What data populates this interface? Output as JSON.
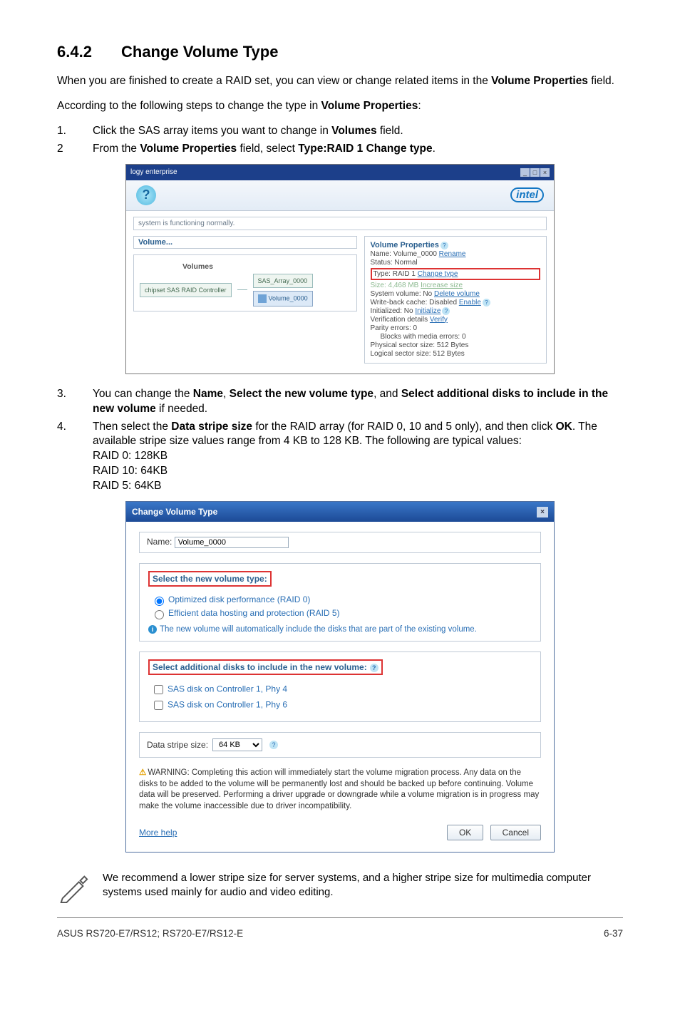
{
  "section": {
    "number": "6.4.2",
    "title": "Change Volume Type"
  },
  "para1": "When you are finished to create a RAID set, you can view or change related items in the ",
  "para1_b": "Volume Properties",
  "para1_tail": " field.",
  "para2_a": "According to the following steps to change the type in ",
  "para2_b": "Volume Properties",
  "para2_tail": ":",
  "step1_a": "Click the SAS array items you want to change in ",
  "step1_b": "Volumes",
  "step1_tail": " field.",
  "step2_a": "From the ",
  "step2_b1": "Volume Properties",
  "step2_mid": " field, select ",
  "step2_b2": "Type:RAID 1 Change type",
  "step2_tail": ".",
  "shot1": {
    "titlebar": "logy enterprise",
    "status": "system is functioning normally.",
    "left_hdr": "Volume...",
    "volumes_label": "Volumes",
    "ctrl_label": "chipset SAS RAID Controller",
    "sas_label": "SAS_Array_0000",
    "vol_label": "Volume_0000",
    "right_hdr": "Volume Properties",
    "r_name_lbl": "Name: Volume_0000 ",
    "r_name_link": "Rename",
    "r_status": "Status: Normal",
    "r_type_a": "Type: RAID 1 ",
    "r_type_link": "Change type",
    "r_size_a": "Size: 4,468 MB ",
    "r_size_link": "Increase size",
    "r_sysvol_a": "System volume: No ",
    "r_sysvol_link": "Delete volume",
    "r_wb_a": "Write-back cache: Disabled ",
    "r_wb_link": "Enable",
    "r_init_a": "Initialized: No ",
    "r_init_link": "Initialize",
    "r_verify_a": "Verification details ",
    "r_verify_link": "Verify",
    "r_parity": "Parity errors: 0",
    "r_blocks": "Blocks with media errors: 0",
    "r_psec": "Physical sector size: 512 Bytes",
    "r_lsec": "Logical sector size: 512 Bytes"
  },
  "step3_a": "You can change the ",
  "step3_b1": "Name",
  "step3_mid1": ", ",
  "step3_b2": "Select the new volume type",
  "step3_mid2": ", and ",
  "step3_b3": "Select additional disks to include in the new volume",
  "step3_tail": " if needed.",
  "step4_a": "Then select the ",
  "step4_b1": "Data stripe size",
  "step4_mid": " for the RAID array (for RAID 0, 10 and 5 only), and then click ",
  "step4_b2": "OK",
  "step4_tail": ". The available stripe size values range from 4 KB to 128 KB. The following are typical values:",
  "step4_l1": "RAID 0: 128KB",
  "step4_l2": "RAID 10: 64KB",
  "step4_l3": "RAID 5: 64KB",
  "shot2": {
    "title": "Change Volume Type",
    "name_lbl": "Name:",
    "name_val": "Volume_0000",
    "grp1_hdr": "Select the new volume type:",
    "r1": "Optimized disk performance (RAID 0)",
    "r2": "Efficient data hosting and protection (RAID 5)",
    "info": "The new volume will automatically include the disks that are part of the existing volume.",
    "grp2_hdr": "Select additional disks to include in the new volume:",
    "c1": "SAS disk on Controller 1, Phy 4",
    "c2": "SAS disk on Controller 1, Phy 6",
    "stripe_lbl": "Data stripe size:",
    "stripe_val": "64 KB",
    "warn": "WARNING: Completing this action will immediately start the volume migration process. Any data on the disks to be added to the volume will be permanently lost and should be backed up before continuing. Volume data will be preserved. Performing a driver upgrade or downgrade while a volume migration is in progress may make the volume inaccessible due to driver incompatibility.",
    "more": "More help",
    "ok": "OK",
    "cancel": "Cancel"
  },
  "note": "We recommend a lower stripe size for server systems, and a higher stripe size for multimedia computer systems used mainly for audio and video editing.",
  "footer_left": "ASUS RS720-E7/RS12; RS720-E7/RS12-E",
  "footer_right": "6-37"
}
